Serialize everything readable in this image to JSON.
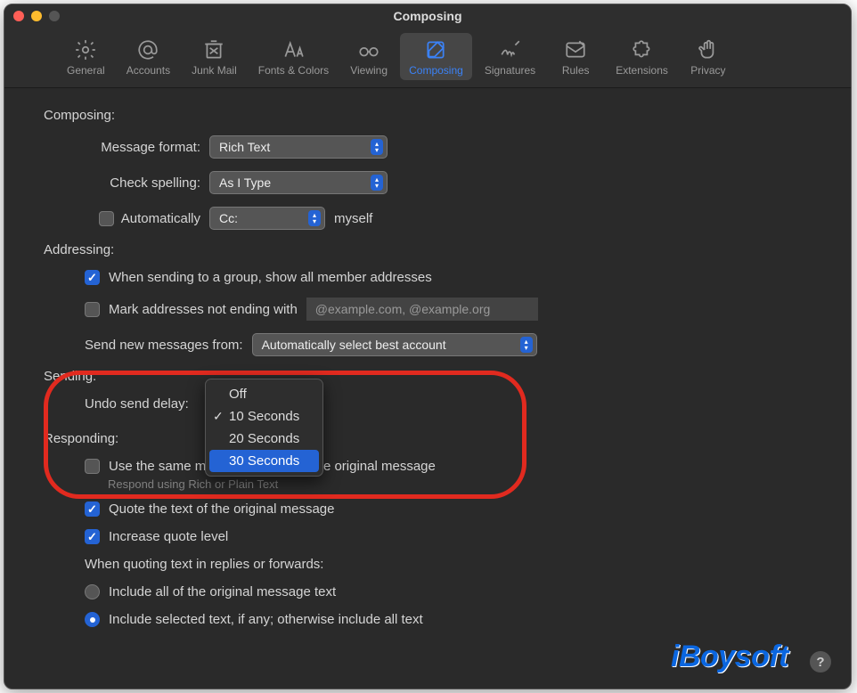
{
  "window": {
    "title": "Composing"
  },
  "toolbar": {
    "tabs": [
      {
        "label": "General"
      },
      {
        "label": "Accounts"
      },
      {
        "label": "Junk Mail"
      },
      {
        "label": "Fonts & Colors"
      },
      {
        "label": "Viewing"
      },
      {
        "label": "Composing"
      },
      {
        "label": "Signatures"
      },
      {
        "label": "Rules"
      },
      {
        "label": "Extensions"
      },
      {
        "label": "Privacy"
      }
    ],
    "active_index": 5
  },
  "composing": {
    "title": "Composing:",
    "message_format_label": "Message format:",
    "message_format_value": "Rich Text",
    "check_spelling_label": "Check spelling:",
    "check_spelling_value": "As I Type",
    "auto_cc_label": "Automatically",
    "auto_cc_value": "Cc:",
    "auto_cc_suffix": "myself"
  },
  "addressing": {
    "title": "Addressing:",
    "group_label": "When sending to a group, show all member addresses",
    "mark_label": "Mark addresses not ending with",
    "mark_placeholder": "@example.com, @example.org",
    "send_from_label": "Send new messages from:",
    "send_from_value": "Automatically select best account"
  },
  "sending": {
    "title": "Sending:",
    "undo_label": "Undo send delay:",
    "dropdown": {
      "options": [
        "Off",
        "10 Seconds",
        "20 Seconds",
        "30 Seconds"
      ],
      "selected": 1,
      "highlighted": 3
    }
  },
  "responding": {
    "title": "Responding:",
    "same_format_label": "Use the same message format as the original message",
    "same_format_sub": "Respond using Rich or Plain Text",
    "quote_label": "Quote the text of the original message",
    "increase_label": "Increase quote level",
    "when_quoting_label": "When quoting text in replies or forwards:",
    "include_all_label": "Include all of the original message text",
    "include_selected_label": "Include selected text, if any; otherwise include all text"
  },
  "brand": "iBoysoft",
  "help": "?"
}
